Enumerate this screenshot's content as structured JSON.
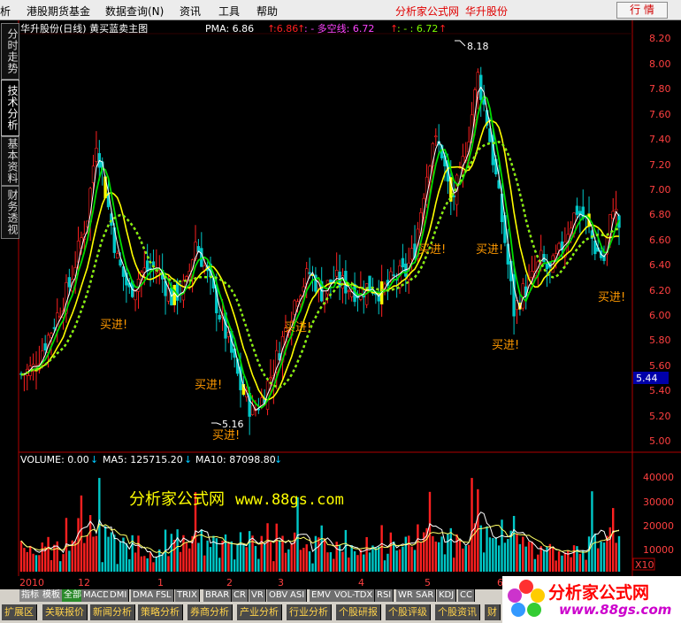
{
  "menu": {
    "items": [
      "析",
      "港股期货基金",
      "数据查询(N)",
      "资讯",
      "工具",
      "帮助"
    ],
    "brand_site": "分析家公式网",
    "brand_stock": "华升股份",
    "quote_button": "行 情"
  },
  "side_tabs": [
    "分时走势",
    "技术分析",
    "基本资料",
    "财务透视"
  ],
  "chart_header": {
    "title": "华升股份(日线) 黄买蓝卖主图",
    "pma_label": "PMA: 6.86",
    "pma_arrow": "↑",
    "v2": ":6.86",
    "v2_arrow": "↑",
    "dk_label": ": - 多空线: 6.72",
    "dk_arrow": "↑",
    "v4": ": - : 6.72",
    "v4_arrow": "↑"
  },
  "price_axis": {
    "ticks": [
      "8.20",
      "8.00",
      "7.80",
      "7.60",
      "7.40",
      "7.20",
      "7.00",
      "6.80",
      "6.60",
      "6.40",
      "6.20",
      "6.00",
      "5.80",
      "5.60",
      "5.40",
      "5.20",
      "5.00"
    ],
    "current_price": "5.44",
    "high_label": "8.18",
    "low_label": "5.16"
  },
  "buy_signals": [
    "买进!",
    "买进!",
    "买进!",
    "买进!",
    "买进!",
    "买进!",
    "买进!",
    "买进!"
  ],
  "volume_header": {
    "volume": "VOLUME: 0.00",
    "ma5": "MA5: 125715.20",
    "ma10": "MA10: 87098.80",
    "arrow": "↓"
  },
  "volume_axis": {
    "ticks": [
      "40000",
      "30000",
      "20000",
      "10000"
    ],
    "multiplier": "X10"
  },
  "watermark": {
    "name": "分析家公式网",
    "url": "www.88gs.com"
  },
  "time_axis": {
    "labels": [
      "2010年",
      "12",
      "1",
      "2",
      "3",
      "4",
      "5",
      "6"
    ]
  },
  "indicator_tabs": [
    "指标",
    "模板",
    "全部",
    "MACD",
    "DMI",
    "DMA",
    "FSL",
    "TRIX",
    "BRAR",
    "CR",
    "VR",
    "OBV",
    "ASI",
    "EMV",
    "VOL-TDX",
    "RSI",
    "WR",
    "SAR",
    "KDJ",
    "CC"
  ],
  "function_tabs": [
    "扩展区",
    "关联报价",
    "新闻分析",
    "策略分析",
    "券商分析",
    "产业分析",
    "行业分析",
    "个股研报",
    "个股评级",
    "个股资讯",
    "财"
  ],
  "logo": {
    "name": "分析家公式网",
    "url": "www.88gs.com"
  },
  "colors": {
    "up": "#ff2020",
    "down": "#00c8c8",
    "flat": "#ffff00",
    "ma_yellow": "#ffff00",
    "ma_green": "#00dd00",
    "ma_white": "#ffffff",
    "dash_magenta": "#ff00ff",
    "dash_green": "#7fff00",
    "axis": "#b00000",
    "signal_text": "#ff9900"
  },
  "chart_data": {
    "type": "candlestick",
    "title": "华升股份(日线) 黄买蓝卖主图",
    "ylim": [
      4.95,
      8.28
    ],
    "low_point": 5.16,
    "high_point": 8.18,
    "last_close": 6.72,
    "price_path": [
      [
        0,
        5.55
      ],
      [
        4,
        5.6
      ],
      [
        10,
        5.9
      ],
      [
        16,
        6.25
      ],
      [
        22,
        6.8
      ],
      [
        25,
        7.4
      ],
      [
        28,
        7.0
      ],
      [
        32,
        6.45
      ],
      [
        36,
        6.2
      ],
      [
        40,
        6.35
      ],
      [
        45,
        6.4
      ],
      [
        50,
        6.15
      ],
      [
        55,
        6.25
      ],
      [
        58,
        6.6
      ],
      [
        61,
        6.4
      ],
      [
        65,
        6.1
      ],
      [
        69,
        5.8
      ],
      [
        73,
        5.45
      ],
      [
        77,
        5.25
      ],
      [
        80,
        5.35
      ],
      [
        84,
        5.6
      ],
      [
        88,
        5.9
      ],
      [
        92,
        6.2
      ],
      [
        96,
        6.35
      ],
      [
        100,
        6.2
      ],
      [
        104,
        6.3
      ],
      [
        108,
        6.25
      ],
      [
        112,
        6.2
      ],
      [
        116,
        6.25
      ],
      [
        120,
        6.2
      ],
      [
        124,
        6.3
      ],
      [
        128,
        6.35
      ],
      [
        131,
        6.55
      ],
      [
        134,
        7.0
      ],
      [
        137,
        7.4
      ],
      [
        140,
        7.3
      ],
      [
        143,
        6.9
      ],
      [
        146,
        7.1
      ],
      [
        149,
        7.45
      ],
      [
        152,
        7.9
      ],
      [
        155,
        7.55
      ],
      [
        158,
        7.1
      ],
      [
        161,
        6.6
      ],
      [
        164,
        6.05
      ],
      [
        167,
        6.2
      ],
      [
        170,
        6.3
      ],
      [
        173,
        6.45
      ],
      [
        176,
        6.35
      ],
      [
        179,
        6.5
      ],
      [
        182,
        6.7
      ],
      [
        185,
        6.85
      ],
      [
        188,
        6.75
      ],
      [
        191,
        6.55
      ],
      [
        194,
        6.45
      ],
      [
        197,
        6.9
      ],
      [
        199,
        6.72
      ]
    ],
    "volume_ticks": [
      40000,
      30000,
      20000,
      10000
    ],
    "volume_ylim": [
      0,
      46000
    ],
    "volume_scale": "X10",
    "ma5_volume": 125715.2,
    "ma10_volume": 87098.8
  }
}
